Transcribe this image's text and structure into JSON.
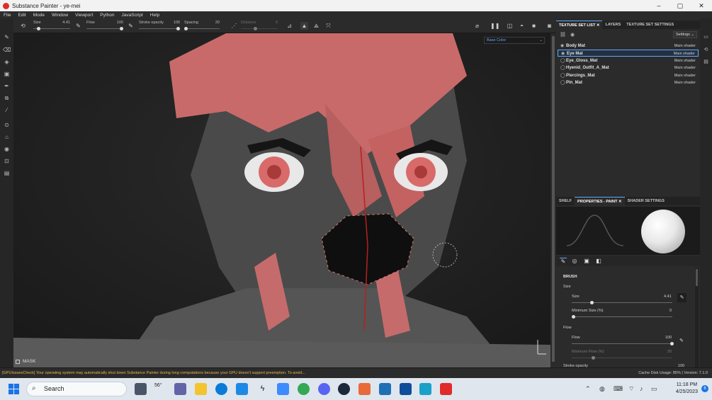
{
  "window": {
    "title": "Substance Painter - ye-mei",
    "minimize": "–",
    "maximize": "▢",
    "close": "✕"
  },
  "menu": [
    "File",
    "Edit",
    "Mode",
    "Window",
    "Viewport",
    "Python",
    "JavaScript",
    "Help"
  ],
  "toolbar": {
    "size_label": "Size",
    "size_value": "4.41",
    "size_level": 0.15,
    "flow_label": "Flow",
    "flow_value": "100",
    "flow_level": 1.0,
    "stroke_opacity_label": "Stroke opacity",
    "stroke_opacity_value": "100",
    "stroke_opacity_level": 1.0,
    "spacing_label": "Spacing",
    "spacing_value": "20",
    "spacing_level": 0.05,
    "distance_label": "Distance",
    "distance_value": "0"
  },
  "viewport": {
    "channel": "Base Color",
    "mask_label": "MASK"
  },
  "texture_set_tabs": [
    "TEXTURE SET LIST",
    "LAYERS",
    "TEXTURE SET SETTINGS"
  ],
  "settings_button": "Settings",
  "texture_sets": [
    {
      "name": "Body Mat",
      "shader": "Main shader",
      "selected": false
    },
    {
      "name": "Eye Mat",
      "shader": "Main shader",
      "selected": true
    },
    {
      "name": "Eye_Gloss_Mat",
      "shader": "Main shader",
      "selected": false
    },
    {
      "name": "Hyenid_Outfit_A_Mat",
      "shader": "Main shader",
      "selected": false
    },
    {
      "name": "Piercings_Mat",
      "shader": "Main shader",
      "selected": false
    },
    {
      "name": "Pin_Mat",
      "shader": "Main shader",
      "selected": false
    }
  ],
  "properties_tabs": [
    "SHELF",
    "PROPERTIES - PAINT",
    "SHADER SETTINGS"
  ],
  "brush": {
    "section": "BRUSH",
    "size_group": "Size",
    "size_label": "Size",
    "size_value": "4.41",
    "size_level": 0.2,
    "min_size_label": "Minimum Size (%)",
    "min_size_value": "0",
    "flow_group": "Flow",
    "flow_label": "Flow",
    "flow_value": "100",
    "min_flow_label": "Minimum Flow (%)",
    "min_flow_value": "20",
    "stroke_opacity_label": "Stroke opacity",
    "stroke_opacity_value": "100"
  },
  "status": {
    "message": "[GPUIssuesCheck] Your operating system may automatically shut down Substance Painter during long computations because your GPU doesn't support preemption. To avoid...",
    "right": "Cache Disk Usage:   85% | Version: 7.1.0"
  },
  "taskbar": {
    "search_placeholder": "Search",
    "weather": "56°",
    "time": "11:18 PM",
    "date": "4/25/2023",
    "notification_count": "6"
  },
  "colors": {
    "accent": "#5fa8ff",
    "brand_red": "#e02b2b",
    "warning": "#e8b84a"
  }
}
